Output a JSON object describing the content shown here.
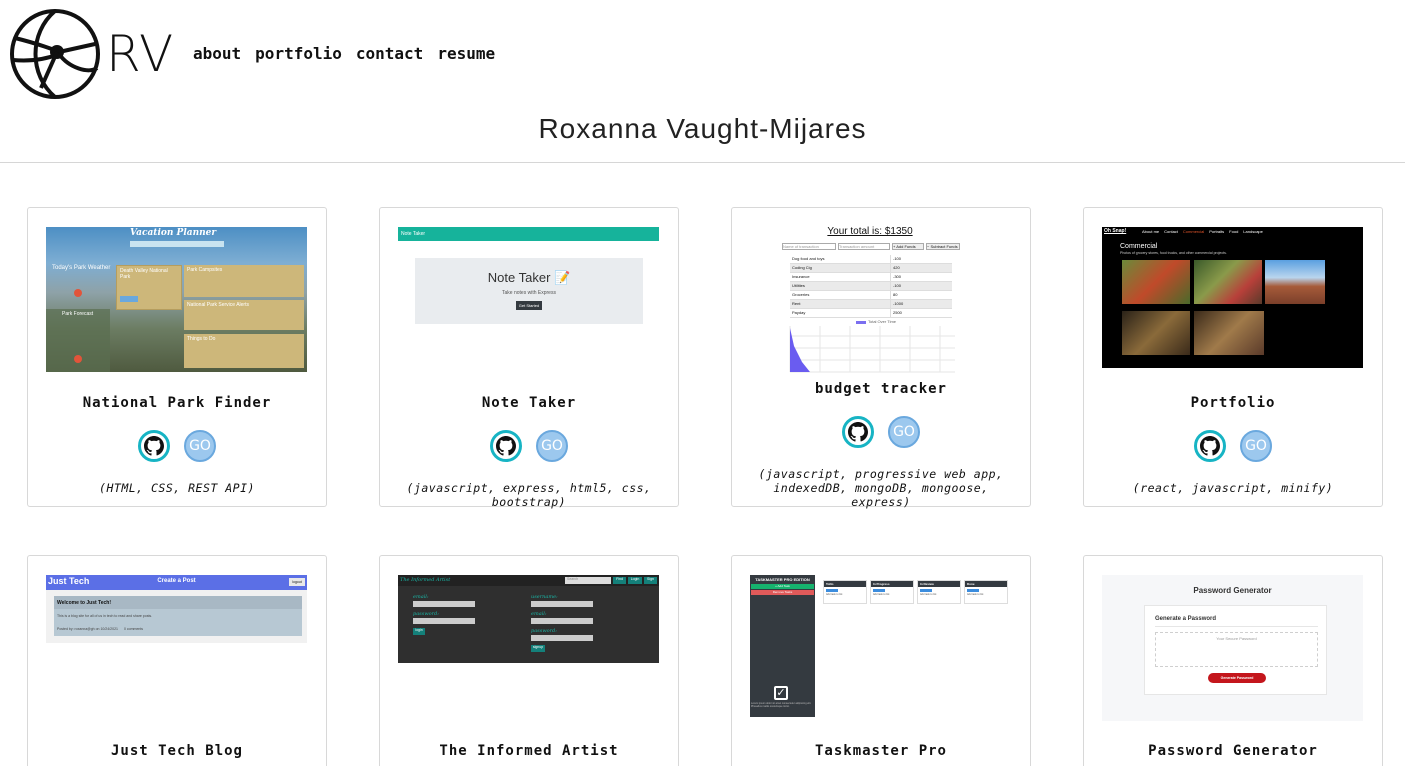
{
  "header": {
    "logo_text": "RV",
    "nav": [
      "about",
      "portfolio",
      "contact",
      "resume"
    ],
    "title": "Roxanna Vaught-Mijares"
  },
  "projects": [
    {
      "title": "National Park Finder",
      "tech": "(HTML, CSS, REST API)",
      "go_label": "GO"
    },
    {
      "title": "Note Taker",
      "tech": "(javascript, express, html5, css, bootstrap)",
      "go_label": "GO"
    },
    {
      "title": "budget tracker",
      "tech": "(javascript, progressive web app, indexedDB, mongoDB, mongoose, express)",
      "go_label": "GO"
    },
    {
      "title": "Portfolio",
      "tech": "(react, javascript, minify)",
      "go_label": "GO"
    },
    {
      "title": "Just Tech Blog"
    },
    {
      "title": "The Informed Artist"
    },
    {
      "title": "Taskmaster Pro"
    },
    {
      "title": "Password Generator"
    }
  ],
  "thumbs": {
    "vacation": {
      "title": "Vacation Planner",
      "weather": "Today's Park Weather",
      "forecast": "Park Forecast",
      "park": "Death Valley National Park",
      "campgrounds": "Park Campsites",
      "alerts": "National Park Service Alerts",
      "things": "Things to Do"
    },
    "notetaker": {
      "brand": "Note Taker",
      "heading": "Note Taker",
      "sub": "Take notes with Express",
      "btn": "Get Started"
    },
    "budget": {
      "total": "Your total is: $1350",
      "name_ph": "Name of transaction",
      "amount_ph": "Transaction amount",
      "add": "+ Add Funds",
      "sub": "− Subtract Funds",
      "rows": [
        [
          "Dog food and toys",
          "-100"
        ],
        [
          "Coding Cig",
          "420"
        ],
        [
          "Insurance",
          "-300"
        ],
        [
          "Utilities",
          "-100"
        ],
        [
          "Groceries",
          "80"
        ],
        [
          "Rent",
          "-1000"
        ],
        [
          "Payday",
          "2500"
        ]
      ],
      "legend": "Total Over Time"
    },
    "portfolio": {
      "brand": "Oh Snap!",
      "nav": [
        "About me",
        "Contact",
        "Commercial",
        "Portraits",
        "Food",
        "Landscape"
      ],
      "heading": "Commercial",
      "desc": "Photos of grocery stores, food trucks, and other commercial projects."
    },
    "justtech": {
      "brand": "Just Tech",
      "center": "Create a Post",
      "btn": "logout",
      "welcome": "Welcome to Just Tech!",
      "body": "This is a blog site for all of us in tech to read and share posts.",
      "meta": "Posted by: roxanna@gh on 10/24/2021",
      "comments": "0 comments"
    },
    "artist": {
      "brand": "The Informed Artist",
      "search": "Search",
      "btns": [
        "Find",
        "Login",
        "Sign"
      ],
      "email": "email:",
      "password": "password:",
      "username": "username:",
      "login": "login",
      "signup": "signup"
    },
    "taskmaster": {
      "brand": "TASKMASTER PRO EDITION",
      "add": "+ Add Task",
      "remove": "Remove Tasks",
      "cols": [
        "ToDo",
        "In Progress",
        "In Review",
        "Done"
      ],
      "task": "Add task to list",
      "footer": "Lorem ipsum dolor sit amet consectetur adipiscing elit. Phasellus mattis scelerisque tortor."
    },
    "password": {
      "heading": "Password Generator",
      "sub": "Generate a Password",
      "placeholder": "Your Secure Password",
      "btn": "Generate Password"
    }
  },
  "colors": {
    "github_ring": "#17b4c4",
    "go_fill": "#9cc8ee",
    "teal": "#16b39b"
  }
}
